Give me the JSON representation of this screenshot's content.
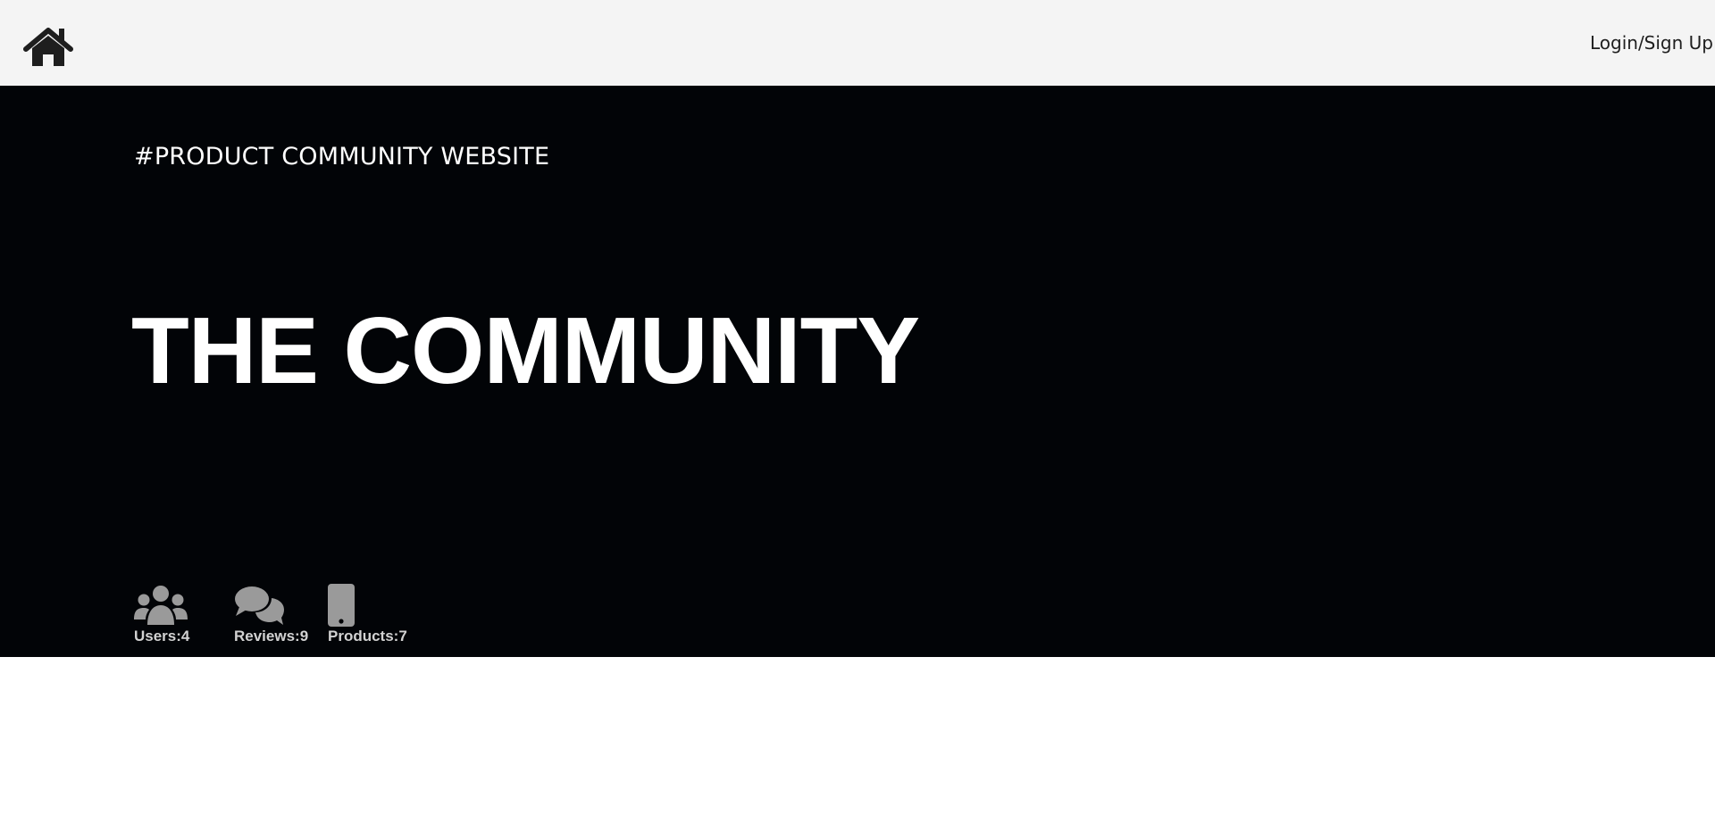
{
  "header": {
    "home_icon": "home-icon",
    "login_label": "Login/Sign Up"
  },
  "hero": {
    "tagline": "#PRODUCT COMMUNITY WEBSITE",
    "title": "THE COMMUNITY",
    "background_color": "#020407",
    "stats": [
      {
        "icon": "users-icon",
        "label": "Users:4"
      },
      {
        "icon": "comments-icon",
        "label": "Reviews:9"
      },
      {
        "icon": "mobile-phone-icon",
        "label": "Products:7"
      }
    ]
  },
  "colors": {
    "header_bg": "#f4f4f4",
    "icon_gray": "#9a9a9a",
    "text_dark": "#1e1e1e"
  }
}
